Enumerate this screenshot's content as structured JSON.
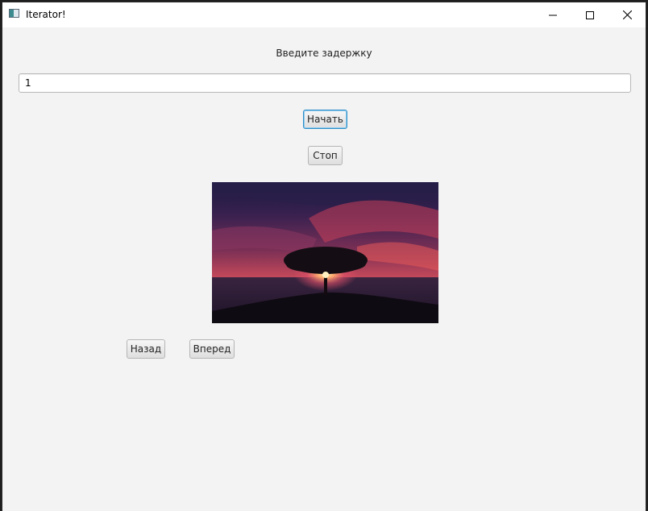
{
  "window": {
    "title": "Iterator!"
  },
  "main": {
    "prompt_label": "Введите задержку",
    "delay_value": "1",
    "start_label": "Начать",
    "stop_label": "Стоп",
    "back_label": "Назад",
    "forward_label": "Вперед"
  },
  "colors": {
    "focus_accent": "#2a8fc9",
    "background": "#f3f3f3"
  },
  "icons": {
    "app": "app-window-icon",
    "minimize": "minimize-icon",
    "maximize": "maximize-icon",
    "close": "close-icon"
  }
}
